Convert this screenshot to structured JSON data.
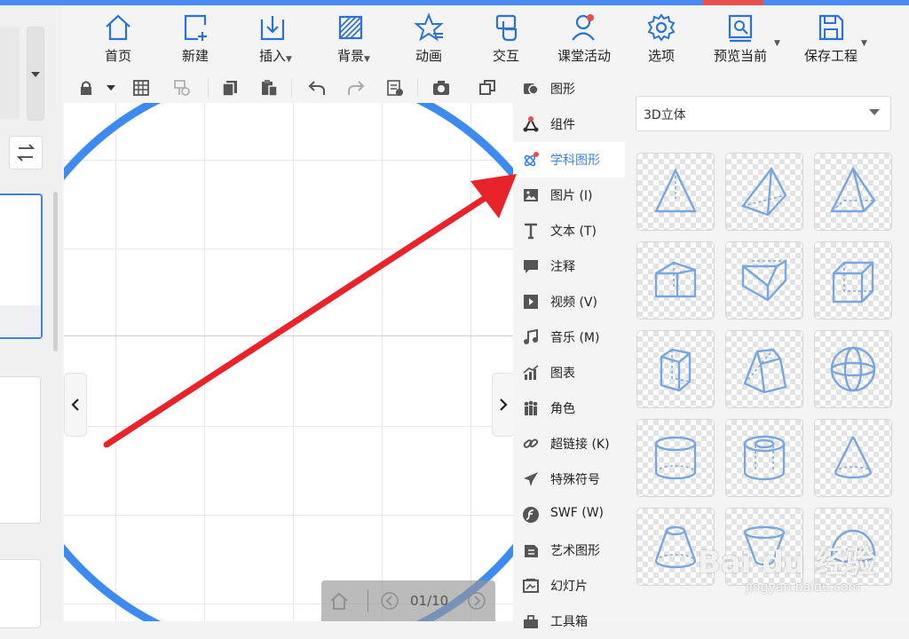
{
  "colors": {
    "accent": "#3b82e6",
    "arrow": "#e8232a",
    "shape_stroke": "#7aa6df",
    "top_strip": "#4a8af4"
  },
  "toolbar": {
    "items": [
      {
        "label": "首页",
        "icon": "home-icon"
      },
      {
        "label": "新建",
        "icon": "new-file-icon"
      },
      {
        "label": "插入",
        "icon": "insert-icon",
        "dropdown": true
      },
      {
        "label": "背景",
        "icon": "background-icon",
        "dropdown": true
      },
      {
        "label": "动画",
        "icon": "animation-star-icon"
      },
      {
        "label": "交互",
        "icon": "interaction-hand-icon"
      },
      {
        "label": "课堂活动",
        "icon": "class-activity-icon"
      },
      {
        "label": "选项",
        "icon": "gear-icon"
      },
      {
        "label": "预览当前",
        "icon": "preview-icon",
        "dropdown": true
      },
      {
        "label": "保存工程",
        "icon": "save-icon",
        "dropdown": true
      }
    ]
  },
  "canvas_toolbar": {
    "icons": [
      "lock-icon",
      "grid-icon",
      "format-painter-icon",
      "copy-icon",
      "paste-icon",
      "undo-icon",
      "redo-icon",
      "notes-icon",
      "camera-icon",
      "window-icon"
    ]
  },
  "pager": {
    "text": "01/10"
  },
  "categories": [
    {
      "label": "图形",
      "icon": "shape-icon"
    },
    {
      "label": "组件",
      "icon": "component-icon"
    },
    {
      "label": "学科图形",
      "icon": "subject-shape-icon",
      "active": true
    },
    {
      "label": "图片 (I)",
      "icon": "image-icon"
    },
    {
      "label": "文本 (T)",
      "icon": "text-icon"
    },
    {
      "label": "注释",
      "icon": "comment-icon"
    },
    {
      "label": "视频 (V)",
      "icon": "video-icon"
    },
    {
      "label": "音乐 (M)",
      "icon": "music-icon"
    },
    {
      "label": "图表",
      "icon": "chart-icon"
    },
    {
      "label": "角色",
      "icon": "role-icon"
    },
    {
      "label": "超链接 (K)",
      "icon": "link-icon"
    },
    {
      "label": "特殊符号",
      "icon": "plane-icon"
    },
    {
      "label": "SWF (W)",
      "icon": "swf-icon"
    },
    {
      "label": "艺术图形",
      "icon": "art-shape-icon"
    },
    {
      "label": "幻灯片",
      "icon": "slide-icon"
    },
    {
      "label": "工具箱",
      "icon": "toolbox-icon"
    }
  ],
  "shape_panel": {
    "dropdown_value": "3D立体",
    "shapes": [
      "tetrahedron",
      "square-pyramid",
      "triangular-pyramid",
      "triangular-prism",
      "inverted-prism",
      "cube",
      "hexagonal-prism",
      "frustum",
      "sphere",
      "cylinder",
      "hollow-cylinder",
      "cone",
      "truncated-cone",
      "bowl",
      "hemisphere"
    ]
  },
  "watermark": {
    "text": "Bai du 经验",
    "sub": "jingyan.baidu.com"
  }
}
